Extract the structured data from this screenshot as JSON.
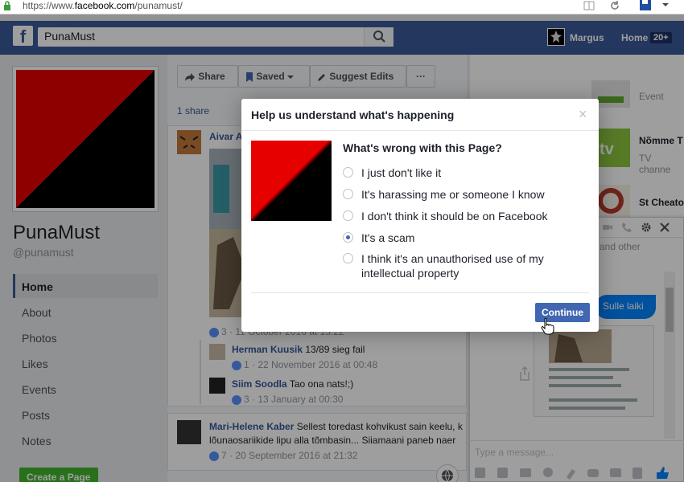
{
  "browser": {
    "url_prefix": "https://www.",
    "url_domain": "facebook.com",
    "url_path": "/punamust/"
  },
  "topbar": {
    "logo": "f",
    "search_value": "PunaMust",
    "user": "Margus",
    "home": "Home",
    "badge": "20+"
  },
  "page": {
    "name": "PunaMust",
    "handle": "@punamust"
  },
  "nav": [
    "Home",
    "About",
    "Photos",
    "Likes",
    "Events",
    "Posts",
    "Notes"
  ],
  "create_page": "Create a Page",
  "actions": {
    "share": "Share",
    "saved": "Saved",
    "suggest": "Suggest Edits",
    "more": "···"
  },
  "share_count": "1 share",
  "post": {
    "author": "Aivar A",
    "likes": "3",
    "date": "11 October 2016 at 15:22"
  },
  "comments": [
    {
      "name": "Herman Kuusik",
      "text": "13/89 sieg fail",
      "likes": "1",
      "date": "22 November 2016 at 00:48"
    },
    {
      "name": "Siim Soodla",
      "text": "Tao ona nats!;)",
      "likes": "3",
      "date": "13 January at 00:30"
    }
  ],
  "post2": {
    "author": "Mari-Helene Kaber",
    "text1": "Sellest toredast kohvikust sain keelu, k",
    "text2": "lõunaosariikide lipu alla tõmbasin... Siiamaani paneb naer",
    "likes": "7",
    "date": "20 September 2016 at 21:32"
  },
  "right": {
    "item1": "Event",
    "item2": "Nõmme T",
    "item2_sub": "TV channe",
    "item3": "St Cheato",
    "chat_and_other": "and other",
    "chat_bubble": "Sulle laiki",
    "chat_placeholder": "Type a message..."
  },
  "dialog": {
    "title": "Help us understand what's happening",
    "close": "×",
    "question": "What's wrong with this Page?",
    "options": [
      {
        "label": "I just don't like it",
        "checked": false
      },
      {
        "label": "It's harassing me or someone I know",
        "checked": false
      },
      {
        "label": "I don't think it should be on Facebook",
        "checked": false
      },
      {
        "label": "It's a scam",
        "checked": true
      },
      {
        "label": "I think it's an unauthorised use of my intellectual property",
        "checked": false
      }
    ],
    "continue": "Continue"
  },
  "colors": {
    "fb_blue": "#3b5998",
    "button_blue": "#4267b2",
    "red": "#e60000",
    "black": "#000000"
  }
}
